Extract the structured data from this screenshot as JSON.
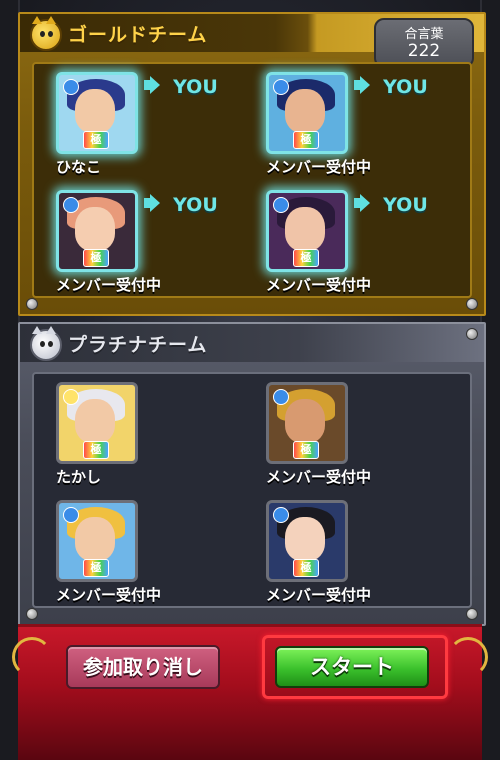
{
  "gold_team": {
    "title": "ゴールドチーム",
    "passcode_label": "合言葉",
    "passcode_value": "222",
    "members": [
      {
        "name": "ひなこ",
        "you_label": "YOU"
      },
      {
        "name": "メンバー受付中",
        "you_label": "YOU"
      },
      {
        "name": "メンバー受付中",
        "you_label": "YOU"
      },
      {
        "name": "メンバー受付中",
        "you_label": "YOU"
      }
    ]
  },
  "platinum_team": {
    "title": "プラチナチーム",
    "members": [
      {
        "name": "たかし"
      },
      {
        "name": "メンバー受付中"
      },
      {
        "name": "メンバー受付中"
      },
      {
        "name": "メンバー受付中"
      }
    ]
  },
  "badge_label": "極",
  "actions": {
    "cancel_label": "参加取り消し",
    "start_label": "スタート"
  },
  "colors": {
    "gold_accent": "#ffd34a",
    "you_text": "#6fe6e6",
    "start_button": "#3bc12c",
    "cancel_button": "#c04f70",
    "action_bar": "#b81424"
  },
  "icons": {
    "gold_emblem": "cat-face-gold-icon",
    "platinum_emblem": "cat-face-white-icon",
    "you_indicator": "speaker-icon"
  }
}
